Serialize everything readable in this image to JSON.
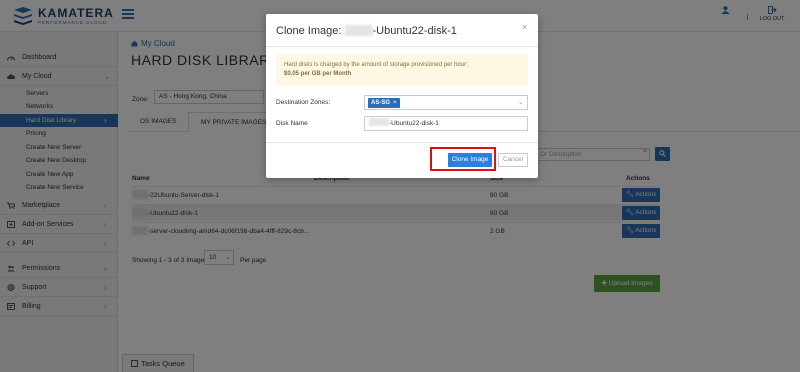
{
  "brand": {
    "name": "KAMATERA",
    "tagline": "PERFORMANCE CLOUD"
  },
  "topbar": {
    "user_label": "",
    "logout_label": "LOG OUT"
  },
  "sidebar": {
    "dashboard": "Dashboard",
    "my_cloud": "My Cloud",
    "sub_items": [
      "Servers",
      "Networks",
      "Hard Disk Library",
      "Pricing",
      "Create New Server",
      "Create New Desktop",
      "Create New App",
      "Create New Service"
    ],
    "marketplace": "Marketplace",
    "addon": "Add-on Services",
    "api": "API",
    "permissions": "Permissions",
    "support": "Support",
    "billing": "Billing"
  },
  "main": {
    "breadcrumb": "My Cloud",
    "title": "HARD DISK LIBRARY",
    "zone_label": "Zone:",
    "zone_value": "AS - Hong Kong, China",
    "tabs": [
      "OS IMAGES",
      "MY PRIVATE IMAGES"
    ],
    "search_placeholder": "Or Description",
    "columns": {
      "name": "Name",
      "description": "Description",
      "size": "Size",
      "actions": "Actions"
    },
    "rows": [
      {
        "name": "-22Ubuntu-Server-disk-1",
        "size": "80 GB",
        "action": "Actions"
      },
      {
        "name": "-Ubuntu22-disk-1",
        "size": "80 GB",
        "action": "Actions"
      },
      {
        "name": "-server-cloudimg-amd64-dc06f198-dba4-4fff-829c-8cb...",
        "size": "2 GB",
        "action": "Actions"
      }
    ],
    "showing": "Showing 1 - 3 of 3 Images,",
    "per_page_value": "10",
    "per_page_label": "Per page",
    "upload": "Upload Images",
    "tasks_queue": "Tasks Queue"
  },
  "modal": {
    "title": "Clone Image:",
    "title_suffix": "-Ubuntu22-disk-1",
    "alert_line1": "Hard disks is charged by the amount of storage provisioned per hour:",
    "alert_line2": "$0.05 per GB per Month",
    "dest_label": "Destination Zones:",
    "dest_tag": "AS-SG",
    "disk_label": "Disk Name",
    "disk_value": "-Ubuntu22-disk-1",
    "clone_button": "Clone Image",
    "cancel_button": "Cancel"
  },
  "colors": {
    "primary": "#2e6db4",
    "upload": "#5aa545",
    "highlight": "#e01010"
  }
}
